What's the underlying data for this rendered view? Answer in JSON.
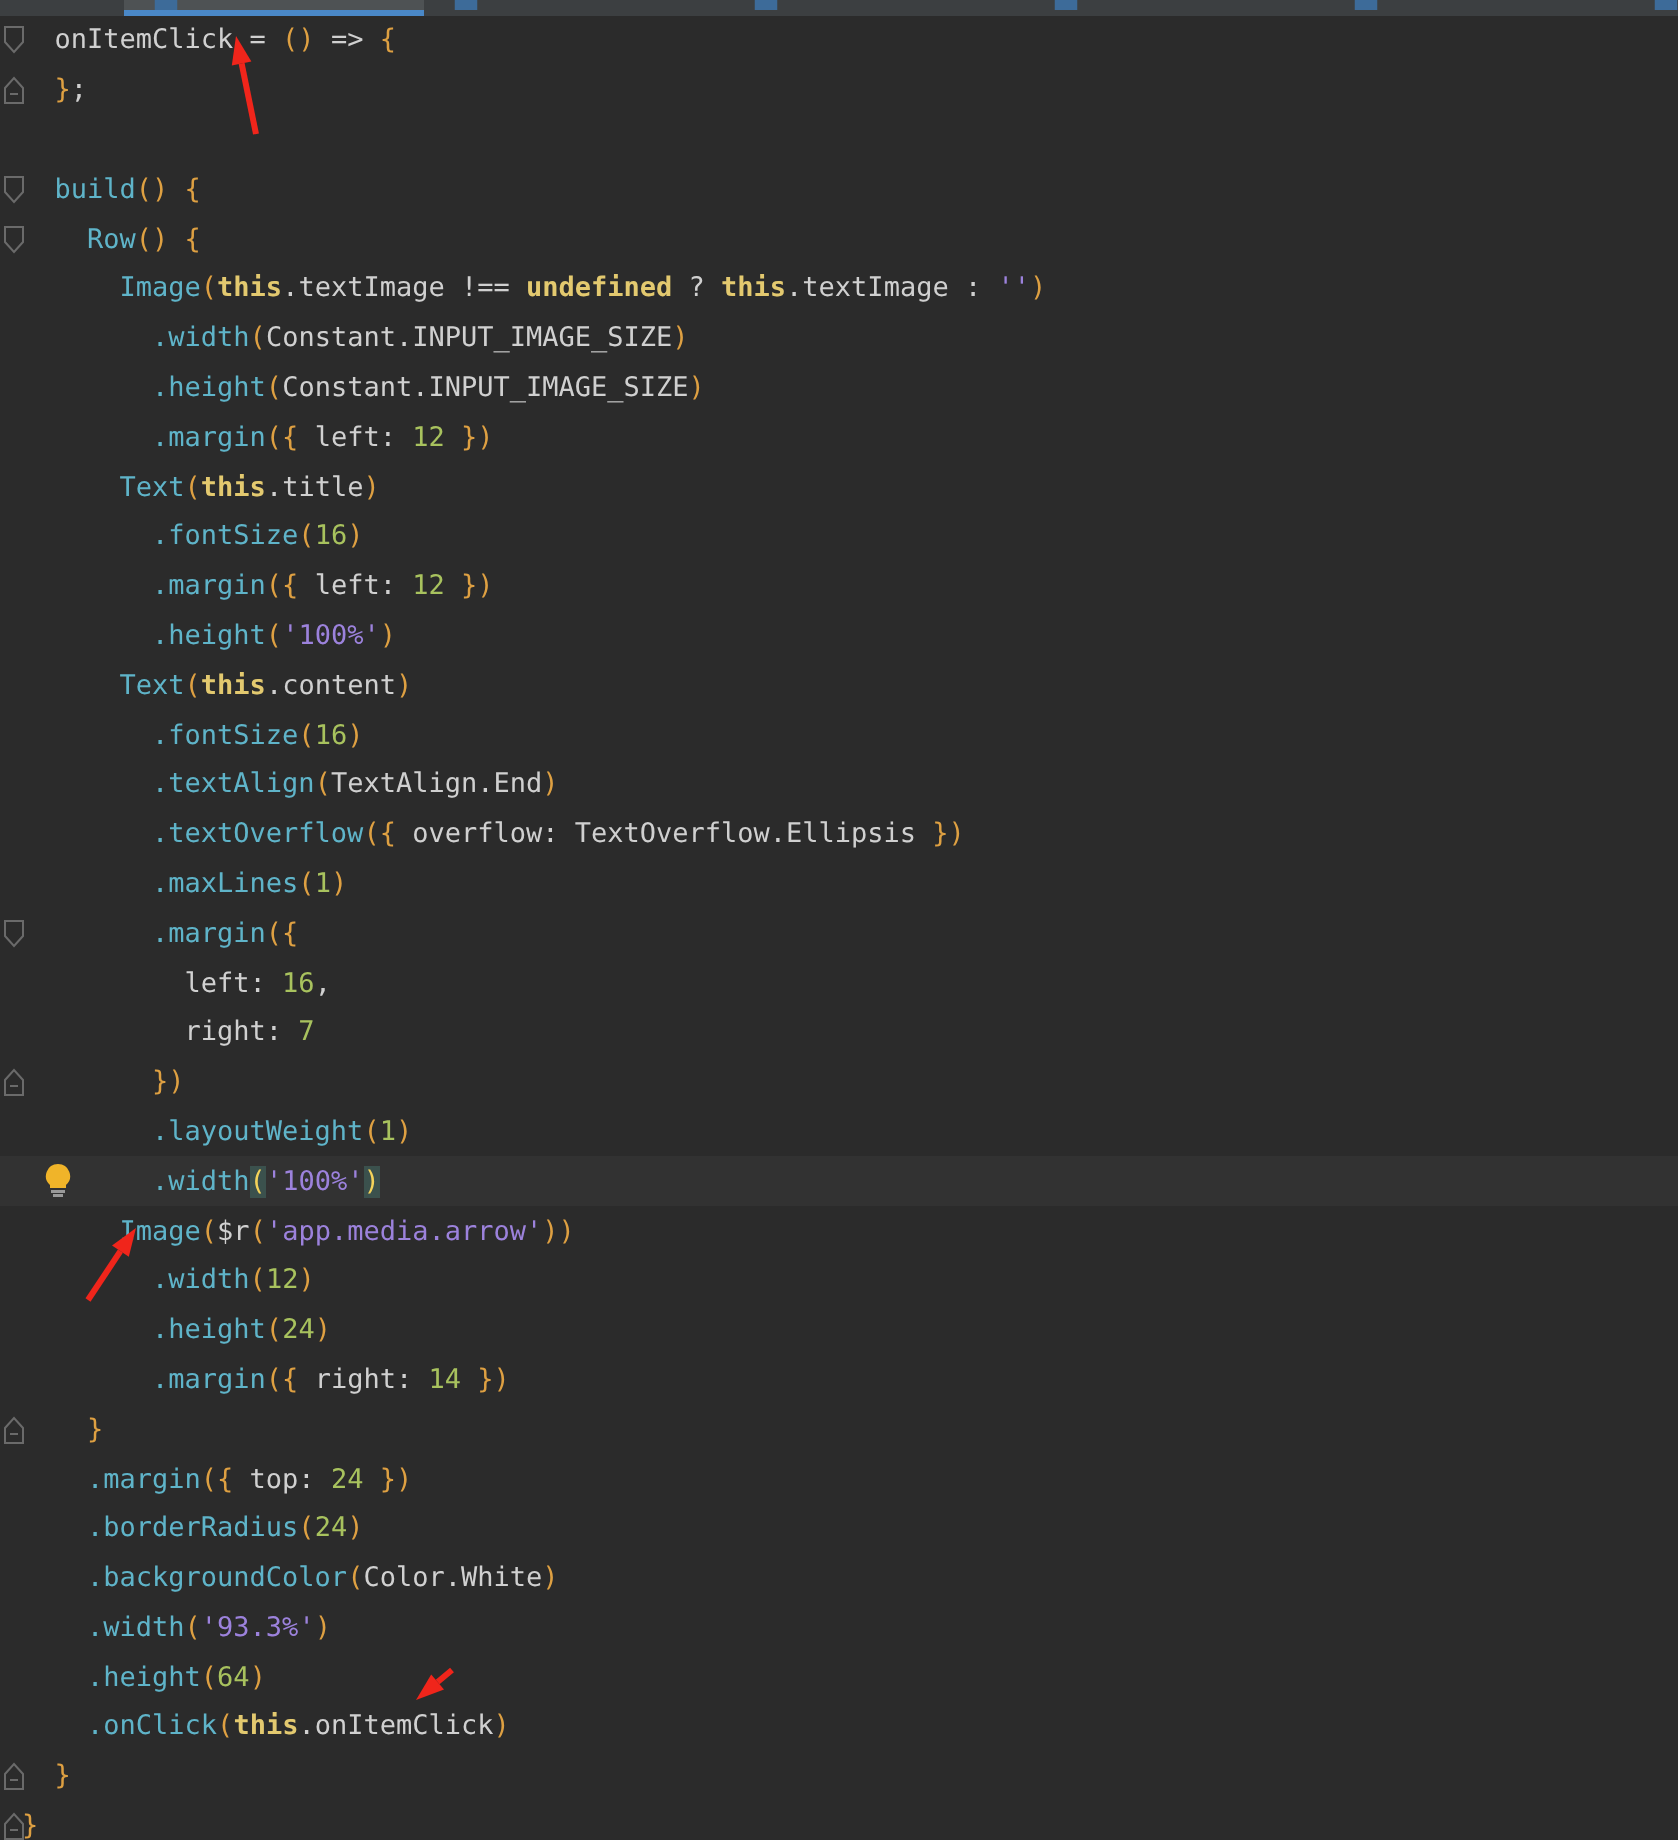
{
  "tabs": [
    {
      "selected": true
    },
    {
      "selected": false
    },
    {
      "selected": false
    },
    {
      "selected": false
    },
    {
      "selected": false
    },
    {
      "selected": false
    }
  ],
  "editor": {
    "lines": [
      {
        "kind": "opener",
        "current": false,
        "tokens": [
          {
            "kind": "p",
            "text": "  onItemClick = "
          },
          {
            "kind": "b",
            "text": "()"
          },
          {
            "kind": "p",
            "text": " => "
          },
          {
            "kind": "b",
            "text": "{"
          }
        ]
      },
      {
        "kind": "closer",
        "current": false,
        "tokens": [
          {
            "kind": "b",
            "text": "  }"
          },
          {
            "kind": "p",
            "text": ";"
          }
        ]
      },
      {
        "kind": "plain",
        "current": false
      },
      {
        "kind": "opener",
        "current": false,
        "tokens": [
          {
            "kind": "f",
            "text": "  build"
          },
          {
            "kind": "b",
            "text": "() {"
          }
        ]
      },
      {
        "kind": "opener",
        "current": false,
        "tokens": [
          {
            "kind": "f",
            "text": "    Row"
          },
          {
            "kind": "b",
            "text": "() {"
          }
        ]
      },
      {
        "kind": "plain",
        "current": false,
        "tokens": [
          {
            "kind": "f",
            "text": "      Image"
          },
          {
            "kind": "b",
            "text": "("
          },
          {
            "kind": "k",
            "text": "this"
          },
          {
            "kind": "p",
            "text": ".textImage !== "
          },
          {
            "kind": "k",
            "text": "undefined"
          },
          {
            "kind": "p",
            "text": " ? "
          },
          {
            "kind": "k",
            "text": "this"
          },
          {
            "kind": "p",
            "text": ".textImage : "
          },
          {
            "kind": "s",
            "text": "''"
          },
          {
            "kind": "b",
            "text": ")"
          }
        ]
      },
      {
        "kind": "plain",
        "current": false,
        "tokens": [
          {
            "kind": "f",
            "text": "        .width"
          },
          {
            "kind": "b",
            "text": "("
          },
          {
            "kind": "p",
            "text": "Constant.INPUT_IMAGE_SIZE"
          },
          {
            "kind": "b",
            "text": ")"
          }
        ]
      },
      {
        "kind": "plain",
        "current": false,
        "tokens": [
          {
            "kind": "f",
            "text": "        .height"
          },
          {
            "kind": "b",
            "text": "("
          },
          {
            "kind": "p",
            "text": "Constant.INPUT_IMAGE_SIZE"
          },
          {
            "kind": "b",
            "text": ")"
          }
        ]
      },
      {
        "kind": "plain",
        "current": false,
        "tokens": [
          {
            "kind": "f",
            "text": "        .margin"
          },
          {
            "kind": "b",
            "text": "({"
          },
          {
            "kind": "p",
            "text": " left: "
          },
          {
            "kind": "n",
            "text": "12"
          },
          {
            "kind": "b",
            "text": " })"
          }
        ]
      },
      {
        "kind": "plain",
        "current": false,
        "tokens": [
          {
            "kind": "f",
            "text": "      Text"
          },
          {
            "kind": "b",
            "text": "("
          },
          {
            "kind": "k",
            "text": "this"
          },
          {
            "kind": "p",
            "text": ".title"
          },
          {
            "kind": "b",
            "text": ")"
          }
        ]
      },
      {
        "kind": "plain",
        "current": false,
        "tokens": [
          {
            "kind": "f",
            "text": "        .fontSize"
          },
          {
            "kind": "b",
            "text": "("
          },
          {
            "kind": "n",
            "text": "16"
          },
          {
            "kind": "b",
            "text": ")"
          }
        ]
      },
      {
        "kind": "plain",
        "current": false,
        "tokens": [
          {
            "kind": "f",
            "text": "        .margin"
          },
          {
            "kind": "b",
            "text": "({"
          },
          {
            "kind": "p",
            "text": " left: "
          },
          {
            "kind": "n",
            "text": "12"
          },
          {
            "kind": "b",
            "text": " })"
          }
        ]
      },
      {
        "kind": "plain",
        "current": false,
        "tokens": [
          {
            "kind": "f",
            "text": "        .height"
          },
          {
            "kind": "b",
            "text": "("
          },
          {
            "kind": "s",
            "text": "'100%'"
          },
          {
            "kind": "b",
            "text": ")"
          }
        ]
      },
      {
        "kind": "plain",
        "current": false,
        "tokens": [
          {
            "kind": "f",
            "text": "      Text"
          },
          {
            "kind": "b",
            "text": "("
          },
          {
            "kind": "k",
            "text": "this"
          },
          {
            "kind": "p",
            "text": ".content"
          },
          {
            "kind": "b",
            "text": ")"
          }
        ]
      },
      {
        "kind": "plain",
        "current": false,
        "tokens": [
          {
            "kind": "f",
            "text": "        .fontSize"
          },
          {
            "kind": "b",
            "text": "("
          },
          {
            "kind": "n",
            "text": "16"
          },
          {
            "kind": "b",
            "text": ")"
          }
        ]
      },
      {
        "kind": "plain",
        "current": false,
        "tokens": [
          {
            "kind": "f",
            "text": "        .textAlign"
          },
          {
            "kind": "b",
            "text": "("
          },
          {
            "kind": "p",
            "text": "TextAlign.End"
          },
          {
            "kind": "b",
            "text": ")"
          }
        ]
      },
      {
        "kind": "plain",
        "current": false,
        "tokens": [
          {
            "kind": "f",
            "text": "        .textOverflow"
          },
          {
            "kind": "b",
            "text": "({"
          },
          {
            "kind": "p",
            "text": " overflow: TextOverflow.Ellipsis "
          },
          {
            "kind": "b",
            "text": "})"
          }
        ]
      },
      {
        "kind": "plain",
        "current": false,
        "tokens": [
          {
            "kind": "f",
            "text": "        .maxLines"
          },
          {
            "kind": "b",
            "text": "("
          },
          {
            "kind": "n",
            "text": "1"
          },
          {
            "kind": "b",
            "text": ")"
          }
        ]
      },
      {
        "kind": "opener",
        "current": false,
        "tokens": [
          {
            "kind": "f",
            "text": "        .margin"
          },
          {
            "kind": "b",
            "text": "({"
          }
        ]
      },
      {
        "kind": "plain",
        "current": false,
        "tokens": [
          {
            "kind": "p",
            "text": "          left: "
          },
          {
            "kind": "n",
            "text": "16"
          },
          {
            "kind": "p",
            "text": ","
          }
        ]
      },
      {
        "kind": "plain",
        "current": false,
        "tokens": [
          {
            "kind": "p",
            "text": "          right: "
          },
          {
            "kind": "n",
            "text": "7"
          }
        ]
      },
      {
        "kind": "closer",
        "current": false,
        "tokens": [
          {
            "kind": "b",
            "text": "        })"
          }
        ]
      },
      {
        "kind": "plain",
        "current": false,
        "tokens": [
          {
            "kind": "f",
            "text": "        .layoutWeight"
          },
          {
            "kind": "b",
            "text": "("
          },
          {
            "kind": "n",
            "text": "1"
          },
          {
            "kind": "b",
            "text": ")"
          }
        ]
      },
      {
        "kind": "plain",
        "current": true,
        "tokens": [
          {
            "kind": "f",
            "text": "        .width"
          },
          {
            "kind": "m",
            "text": "("
          },
          {
            "kind": "s",
            "text": "'100%'"
          },
          {
            "kind": "m",
            "text": ")"
          }
        ]
      },
      {
        "kind": "plain",
        "current": false,
        "tokens": [
          {
            "kind": "f",
            "text": "      Image"
          },
          {
            "kind": "b",
            "text": "("
          },
          {
            "kind": "p",
            "text": "$r"
          },
          {
            "kind": "b",
            "text": "("
          },
          {
            "kind": "s",
            "text": "'app.media.arrow'"
          },
          {
            "kind": "b",
            "text": "))"
          }
        ]
      },
      {
        "kind": "plain",
        "current": false,
        "tokens": [
          {
            "kind": "f",
            "text": "        .width"
          },
          {
            "kind": "b",
            "text": "("
          },
          {
            "kind": "n",
            "text": "12"
          },
          {
            "kind": "b",
            "text": ")"
          }
        ]
      },
      {
        "kind": "plain",
        "current": false,
        "tokens": [
          {
            "kind": "f",
            "text": "        .height"
          },
          {
            "kind": "b",
            "text": "("
          },
          {
            "kind": "n",
            "text": "24"
          },
          {
            "kind": "b",
            "text": ")"
          }
        ]
      },
      {
        "kind": "plain",
        "current": false,
        "tokens": [
          {
            "kind": "f",
            "text": "        .margin"
          },
          {
            "kind": "b",
            "text": "({"
          },
          {
            "kind": "p",
            "text": " right: "
          },
          {
            "kind": "n",
            "text": "14"
          },
          {
            "kind": "b",
            "text": " })"
          }
        ]
      },
      {
        "kind": "closer",
        "current": false,
        "tokens": [
          {
            "kind": "b",
            "text": "    }"
          }
        ]
      },
      {
        "kind": "plain",
        "current": false,
        "tokens": [
          {
            "kind": "f",
            "text": "    .margin"
          },
          {
            "kind": "b",
            "text": "({"
          },
          {
            "kind": "p",
            "text": " top: "
          },
          {
            "kind": "n",
            "text": "24"
          },
          {
            "kind": "b",
            "text": " })"
          }
        ]
      },
      {
        "kind": "plain",
        "current": false,
        "tokens": [
          {
            "kind": "f",
            "text": "    .borderRadius"
          },
          {
            "kind": "b",
            "text": "("
          },
          {
            "kind": "n",
            "text": "24"
          },
          {
            "kind": "b",
            "text": ")"
          }
        ]
      },
      {
        "kind": "plain",
        "current": false,
        "tokens": [
          {
            "kind": "f",
            "text": "    .backgroundColor"
          },
          {
            "kind": "b",
            "text": "("
          },
          {
            "kind": "p",
            "text": "Color.White"
          },
          {
            "kind": "b",
            "text": ")"
          }
        ]
      },
      {
        "kind": "plain",
        "current": false,
        "tokens": [
          {
            "kind": "f",
            "text": "    .width"
          },
          {
            "kind": "b",
            "text": "("
          },
          {
            "kind": "s",
            "text": "'93.3%'"
          },
          {
            "kind": "b",
            "text": ")"
          }
        ]
      },
      {
        "kind": "plain",
        "current": false,
        "tokens": [
          {
            "kind": "f",
            "text": "    .height"
          },
          {
            "kind": "b",
            "text": "("
          },
          {
            "kind": "n",
            "text": "64"
          },
          {
            "kind": "b",
            "text": ")"
          }
        ]
      },
      {
        "kind": "plain",
        "current": false,
        "tokens": [
          {
            "kind": "f",
            "text": "    .onClick"
          },
          {
            "kind": "b",
            "text": "("
          },
          {
            "kind": "k",
            "text": "this"
          },
          {
            "kind": "p",
            "text": ".onItemClick"
          },
          {
            "kind": "b",
            "text": ")"
          }
        ]
      },
      {
        "kind": "closer",
        "current": false,
        "tokens": [
          {
            "kind": "b",
            "text": "  }"
          }
        ]
      },
      {
        "kind": "closer",
        "current": false,
        "tokens": [
          {
            "kind": "b",
            "text": "}"
          }
        ]
      }
    ]
  }
}
